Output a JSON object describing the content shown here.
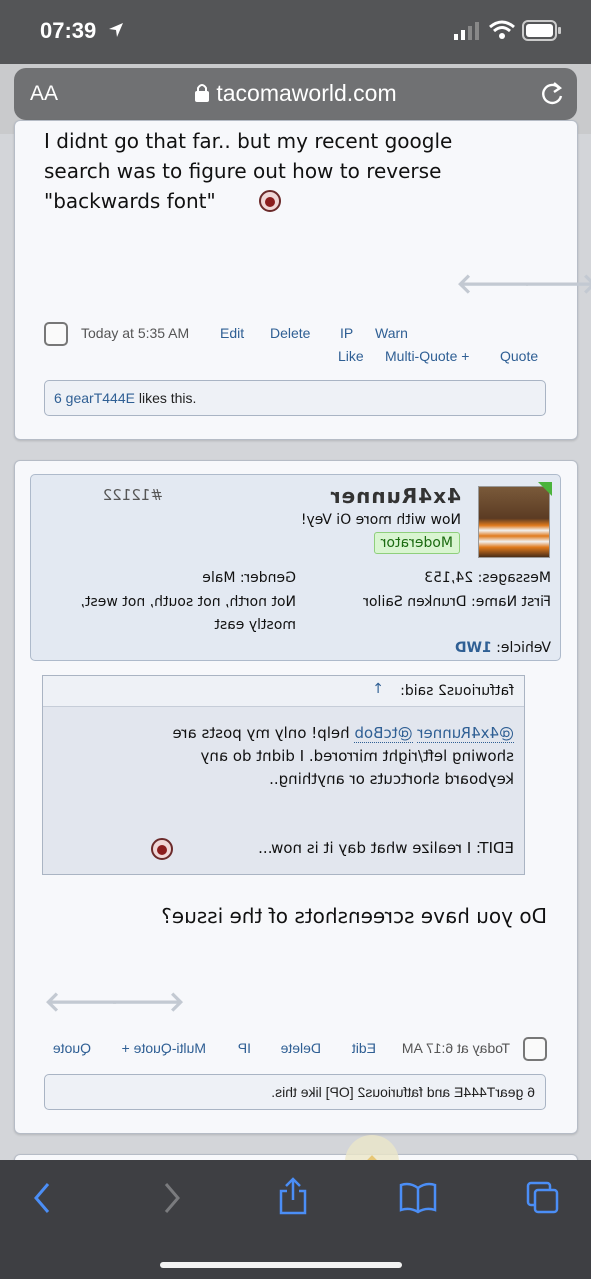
{
  "status": {
    "time": "07:39"
  },
  "browser": {
    "aa_label": "AA",
    "url": "tacomaworld.com"
  },
  "post1": {
    "text_line1": "I didnt go that far.. but my recent google",
    "text_line2": "search was to figure out how to reverse",
    "text_line3": "\"backwards font\"",
    "timestamp": "Today at 5:35 AM",
    "actions_row1": [
      "Edit",
      "Delete",
      "IP",
      "Warn"
    ],
    "actions_row2": [
      "Like",
      "Multi-Quote +",
      "Quote"
    ],
    "likes_user": "6 gearT444E",
    "likes_text": " likes this."
  },
  "post2": {
    "post_number": "#12122",
    "username": "4x4Runner",
    "user_title": "Now with more Oi Vey!",
    "role_badge": "Moderator",
    "stats_left": [
      {
        "label": "Messages:",
        "value": "24,153"
      },
      {
        "label": "First Name:",
        "value": "Drunken Sailor"
      },
      {
        "label": "Vehicle:",
        "value": "1WD"
      }
    ],
    "gender": {
      "label": "Gender:",
      "value": "Male"
    },
    "location_line1": "Not north, not south, not west,",
    "location_line2": "mostly east",
    "quote_author": "fatfurious2 said:",
    "quote_arrow": "↑",
    "quote_mention1": "@4x4Runner",
    "quote_mention2": "@tcBob",
    "quote_line1_rest": " help! only my posts are",
    "quote_line2": "showing left/right mirrored. I didnt do any",
    "quote_line3": "keyboard shortcuts or anything..",
    "quote_edit": "EDIT: I realize what day it is now...",
    "body": "Do you have screenshots of the issue?",
    "timestamp": "Today at 6:17 AM",
    "actions": [
      "Edit",
      "Delete",
      "IP",
      "Multi-Quote +",
      "Quote"
    ],
    "likes_text": "6 gearT444E and fatfurious2 [OP] like this."
  },
  "colors": {
    "link": "#2f5f94",
    "badge_bg": "#d9f5d1",
    "status_bar": "#545557"
  }
}
